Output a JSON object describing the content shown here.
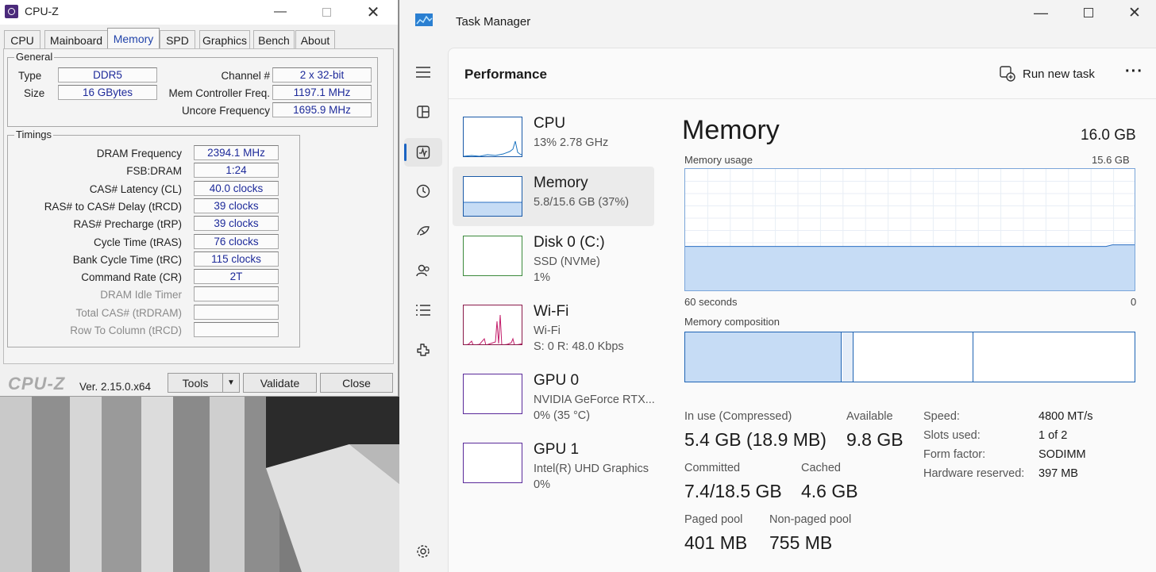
{
  "cpuz": {
    "title": "CPU-Z",
    "tabs": [
      "CPU",
      "Mainboard",
      "Memory",
      "SPD",
      "Graphics",
      "Bench",
      "About"
    ],
    "active_tab": "Memory",
    "general": {
      "label": "General",
      "type_label": "Type",
      "type_value": "DDR5",
      "size_label": "Size",
      "size_value": "16 GBytes",
      "channel_label": "Channel #",
      "channel_value": "2 x 32-bit",
      "mcf_label": "Mem Controller Freq.",
      "mcf_value": "1197.1 MHz",
      "uncore_label": "Uncore Frequency",
      "uncore_value": "1695.9 MHz"
    },
    "timings": {
      "label": "Timings",
      "rows": [
        {
          "label": "DRAM Frequency",
          "value": "2394.1 MHz"
        },
        {
          "label": "FSB:DRAM",
          "value": "1:24"
        },
        {
          "label": "CAS# Latency (CL)",
          "value": "40.0 clocks"
        },
        {
          "label": "RAS# to CAS# Delay (tRCD)",
          "value": "39 clocks"
        },
        {
          "label": "RAS# Precharge (tRP)",
          "value": "39 clocks"
        },
        {
          "label": "Cycle Time (tRAS)",
          "value": "76 clocks"
        },
        {
          "label": "Bank Cycle Time (tRC)",
          "value": "115 clocks"
        },
        {
          "label": "Command Rate (CR)",
          "value": "2T"
        },
        {
          "label": "DRAM Idle Timer",
          "value": ""
        },
        {
          "label": "Total CAS# (tRDRAM)",
          "value": ""
        },
        {
          "label": "Row To Column (tRCD)",
          "value": ""
        }
      ]
    },
    "brand": "CPU-Z",
    "version": "Ver. 2.15.0.x64",
    "tools_label": "Tools",
    "validate_label": "Validate",
    "close_label": "Close"
  },
  "tm": {
    "title": "Task Manager",
    "section": "Performance",
    "run_new_task": "Run new task",
    "resources": [
      {
        "name": "CPU",
        "line1": "13%  2.78 GHz",
        "line2": ""
      },
      {
        "name": "Memory",
        "line1": "5.8/15.6 GB (37%)",
        "line2": ""
      },
      {
        "name": "Disk 0 (C:)",
        "line1": "SSD (NVMe)",
        "line2": "1%"
      },
      {
        "name": "Wi-Fi",
        "line1": "Wi-Fi",
        "line2": "S: 0  R: 48.0 Kbps"
      },
      {
        "name": "GPU 0",
        "line1": "NVIDIA GeForce RTX...",
        "line2": "0%  (35 °C)"
      },
      {
        "name": "GPU 1",
        "line1": "Intel(R) UHD Graphics",
        "line2": "0%"
      }
    ],
    "memory": {
      "heading": "Memory",
      "total": "16.0 GB",
      "usage_label": "Memory usage",
      "usage_max": "15.6 GB",
      "axis_left": "60 seconds",
      "axis_right": "0",
      "usage_fraction": 0.37,
      "composition_label": "Memory composition",
      "in_use_label": "In use (Compressed)",
      "in_use_value": "5.4 GB (18.9 MB)",
      "available_label": "Available",
      "available_value": "9.8 GB",
      "committed_label": "Committed",
      "committed_value": "7.4/18.5 GB",
      "cached_label": "Cached",
      "cached_value": "4.6 GB",
      "paged_label": "Paged pool",
      "paged_value": "401 MB",
      "nonpaged_label": "Non-paged pool",
      "nonpaged_value": "755 MB",
      "specs": [
        {
          "label": "Speed:",
          "value": "4800 MT/s"
        },
        {
          "label": "Slots used:",
          "value": "1 of 2"
        },
        {
          "label": "Form factor:",
          "value": "SODIMM"
        },
        {
          "label": "Hardware reserved:",
          "value": "397 MB"
        }
      ]
    }
  }
}
